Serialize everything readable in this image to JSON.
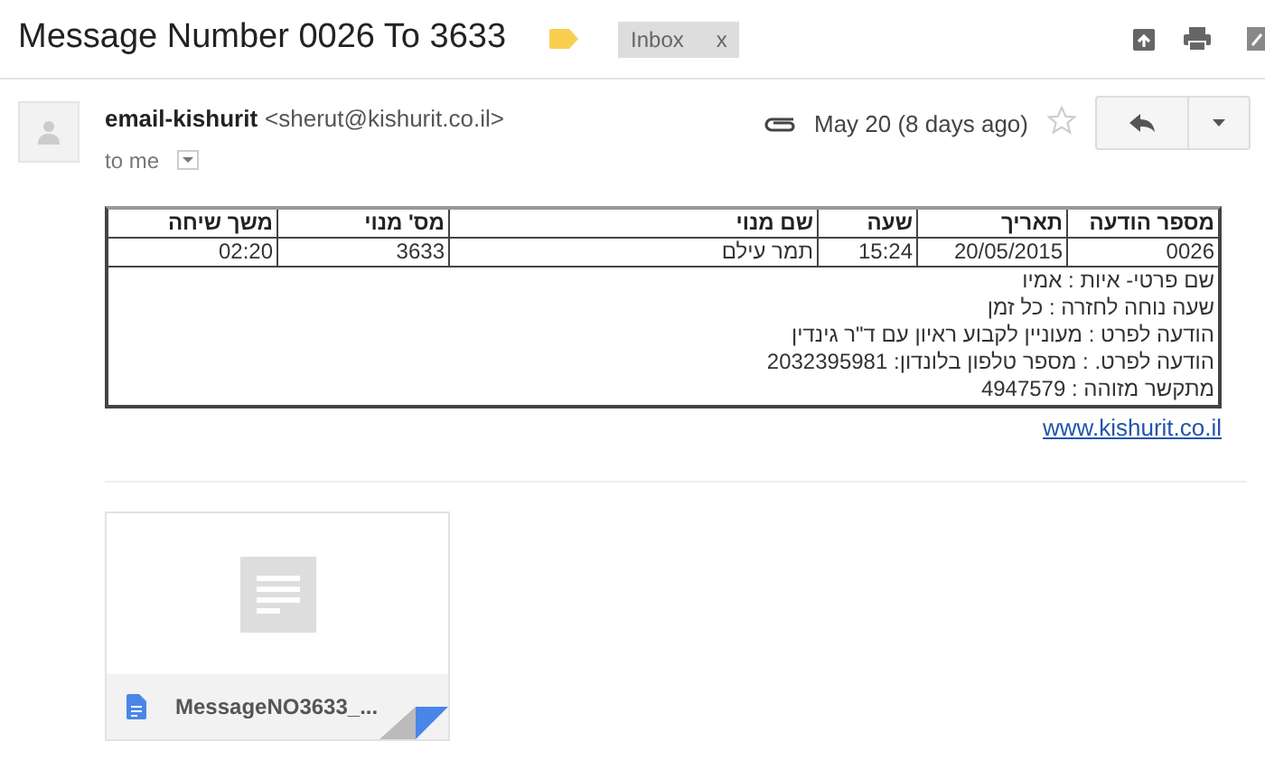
{
  "subject": "Message Number 0026 To 3633",
  "label": {
    "text": "Inbox",
    "close": "x"
  },
  "sender": {
    "name": "email-kishurit",
    "address": "<sherut@kishurit.co.il>",
    "recipient": "to me",
    "date": "May 20 (8 days ago)",
    "starred": false
  },
  "table": {
    "columns": [
      "מספר הודעה",
      "תאריך",
      "שעה",
      "שם מנוי",
      "מס' מנוי",
      "משך שיחה"
    ],
    "row": [
      "0026",
      "20/05/2015",
      "15:24",
      "תמר עילם",
      "3633",
      "02:20"
    ],
    "notes": [
      "שם פרטי- איות : אמיו",
      "שעה נוחה לחזרה : כל זמן",
      "הודעה לפרט : מעוניין לקבוע ראיון עם ד\"ר גינדין",
      "הודעה לפרט. : מספר טלפון בלונדון: 2032395981",
      "מתקשר מזוהה : 4947579"
    ]
  },
  "link": "www.kishurit.co.il",
  "attachment": {
    "name": "MessageNO3633_..."
  }
}
